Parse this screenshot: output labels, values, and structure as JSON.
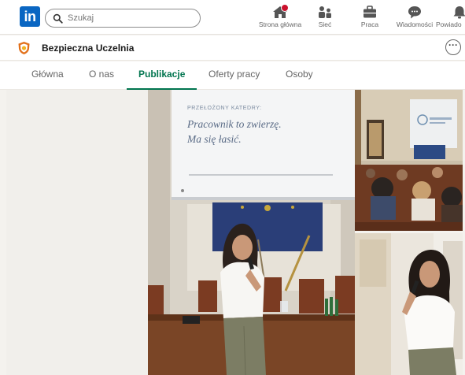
{
  "topnav": {
    "logo": "in",
    "search_placeholder": "Szukaj",
    "items": [
      {
        "label": "Strona główna",
        "icon": "home-icon",
        "has_badge": true
      },
      {
        "label": "Sieć",
        "icon": "network-icon"
      },
      {
        "label": "Praca",
        "icon": "briefcase-icon"
      },
      {
        "label": "Wiadomości",
        "icon": "messaging-icon"
      },
      {
        "label": "Powiado",
        "icon": "bell-icon"
      }
    ]
  },
  "company": {
    "name": "Bezpieczna Uczelnia",
    "more_label": "···"
  },
  "tabs": [
    {
      "label": "Główna"
    },
    {
      "label": "O nas"
    },
    {
      "label": "Publikacje",
      "active": true
    },
    {
      "label": "Oferty pracy"
    },
    {
      "label": "Osoby"
    }
  ],
  "slide": {
    "kicker": "PRZEŁOŻONY KATEDRY:",
    "line1": "Pracownik to zwierzę.",
    "line2": "Ma się łasić."
  },
  "colors": {
    "brand": "#0a66c2",
    "active_tab": "#01754f",
    "badge": "#cb112d"
  }
}
